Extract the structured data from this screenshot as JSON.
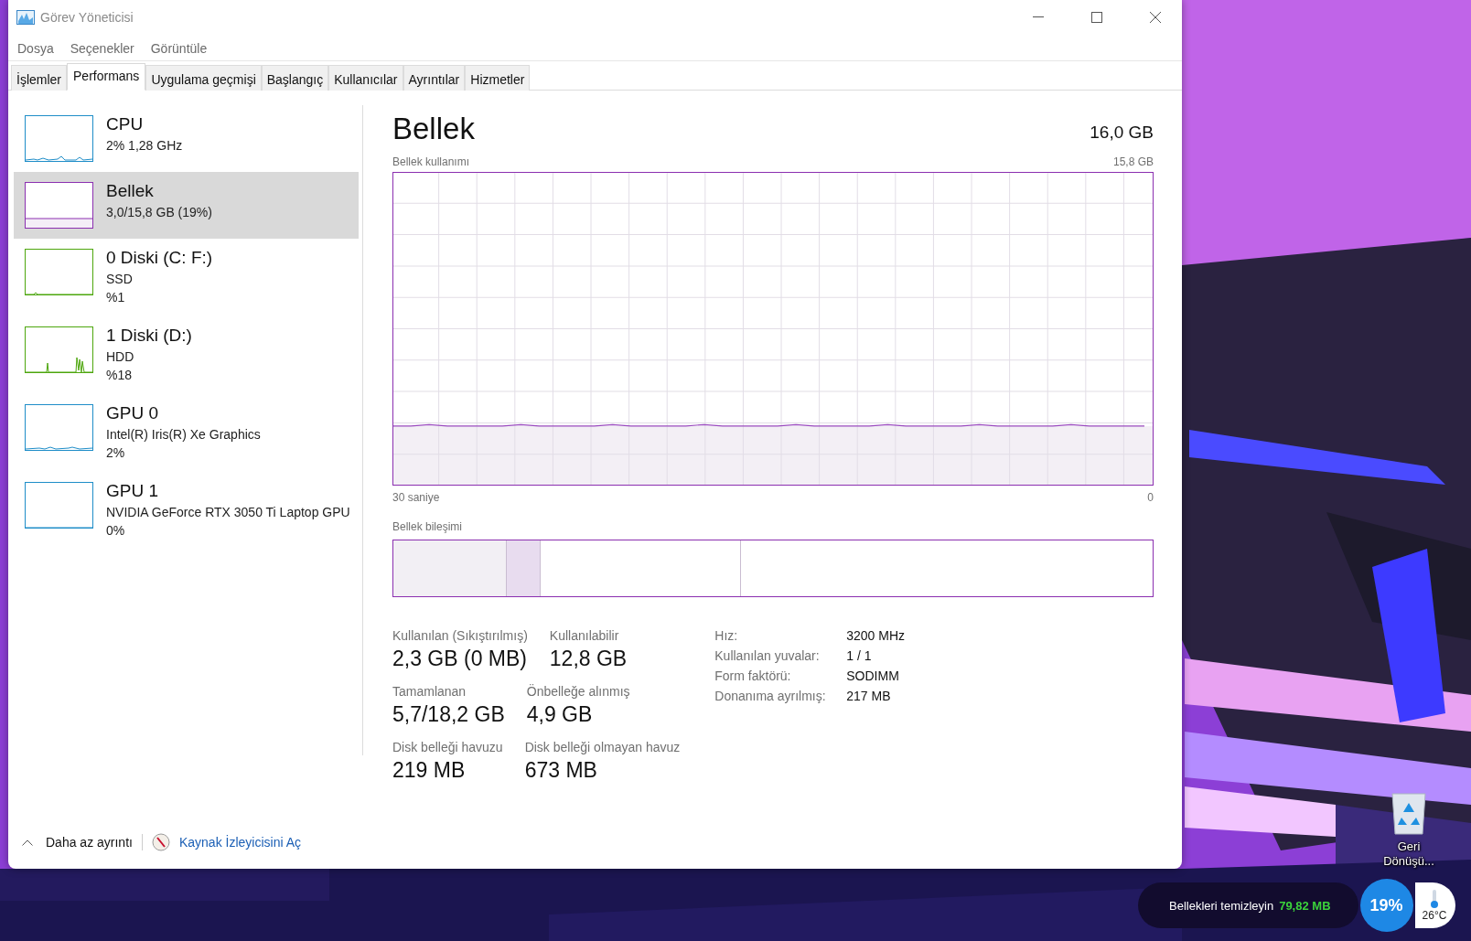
{
  "window": {
    "title": "Görev Yöneticisi"
  },
  "menu": [
    "Dosya",
    "Seçenekler",
    "Görüntüle"
  ],
  "tabs": [
    {
      "label": "İşlemler",
      "selected": false
    },
    {
      "label": "Performans",
      "selected": true
    },
    {
      "label": "Uygulama geçmişi",
      "selected": false
    },
    {
      "label": "Başlangıç",
      "selected": false
    },
    {
      "label": "Kullanıcılar",
      "selected": false
    },
    {
      "label": "Ayrıntılar",
      "selected": false
    },
    {
      "label": "Hizmetler",
      "selected": false
    }
  ],
  "sidebar": {
    "items": [
      {
        "kind": "cpu",
        "color": "#1e8dc8",
        "title": "CPU",
        "lines": [
          "2% 1,28 GHz"
        ],
        "selected": false
      },
      {
        "kind": "memory",
        "color": "#8b2fb0",
        "title": "Bellek",
        "lines": [
          "3,0/15,8 GB (19%)"
        ],
        "selected": true
      },
      {
        "kind": "disk_idle",
        "color": "#4da60c",
        "title": "0 Diski (C: F:)",
        "lines": [
          "SSD",
          "%1"
        ],
        "selected": false
      },
      {
        "kind": "disk_busy",
        "color": "#4da60c",
        "title": "1 Diski (D:)",
        "lines": [
          "HDD",
          "%18"
        ],
        "selected": false
      },
      {
        "kind": "gpu_active",
        "color": "#1e8dc8",
        "title": "GPU 0",
        "lines": [
          "Intel(R) Iris(R) Xe Graphics",
          "2%"
        ],
        "selected": false
      },
      {
        "kind": "gpu_idle",
        "color": "#1e8dc8",
        "title": "GPU 1",
        "lines": [
          "NVIDIA GeForce RTX 3050 Ti Laptop GPU",
          "0%"
        ],
        "selected": false
      }
    ]
  },
  "main": {
    "title": "Bellek",
    "total": "16,0 GB",
    "usage_chart": {
      "label": "Bellek kullanımı",
      "max": "15,8 GB",
      "left_axis": "30 saniye",
      "right_axis": "0"
    },
    "composition": {
      "label": "Bellek bileşimi"
    },
    "stats": [
      [
        {
          "label": "Kullanılan (Sıkıştırılmış)",
          "value": "2,3 GB (0 MB)"
        },
        {
          "label": "Kullanılabilir",
          "value": "12,8 GB"
        }
      ],
      [
        {
          "label": "Tamamlanan",
          "value": "5,7/18,2 GB"
        },
        {
          "label": "Önbelleğe alınmış",
          "value": "4,9 GB"
        }
      ],
      [
        {
          "label": "Disk belleği havuzu",
          "value": "219 MB"
        },
        {
          "label": "Disk belleği olmayan havuz",
          "value": "673 MB"
        }
      ]
    ],
    "details": [
      {
        "label": "Hız:",
        "value": "3200 MHz"
      },
      {
        "label": "Kullanılan yuvalar:",
        "value": "1 / 1"
      },
      {
        "label": "Form faktörü:",
        "value": "SODIMM"
      },
      {
        "label": "Donanıma ayrılmış:",
        "value": "217 MB"
      }
    ]
  },
  "footer": {
    "less_details": "Daha az ayrıntı",
    "resource_monitor": "Kaynak İzleyicisini Aç"
  },
  "desktop": {
    "icons": [
      {
        "label": "Geri Dönüşü..."
      }
    ]
  },
  "widget": {
    "label": "Bellekleri temizleyin",
    "amount": "79,82 MB",
    "percent": "19%",
    "temperature": "26°C"
  }
}
